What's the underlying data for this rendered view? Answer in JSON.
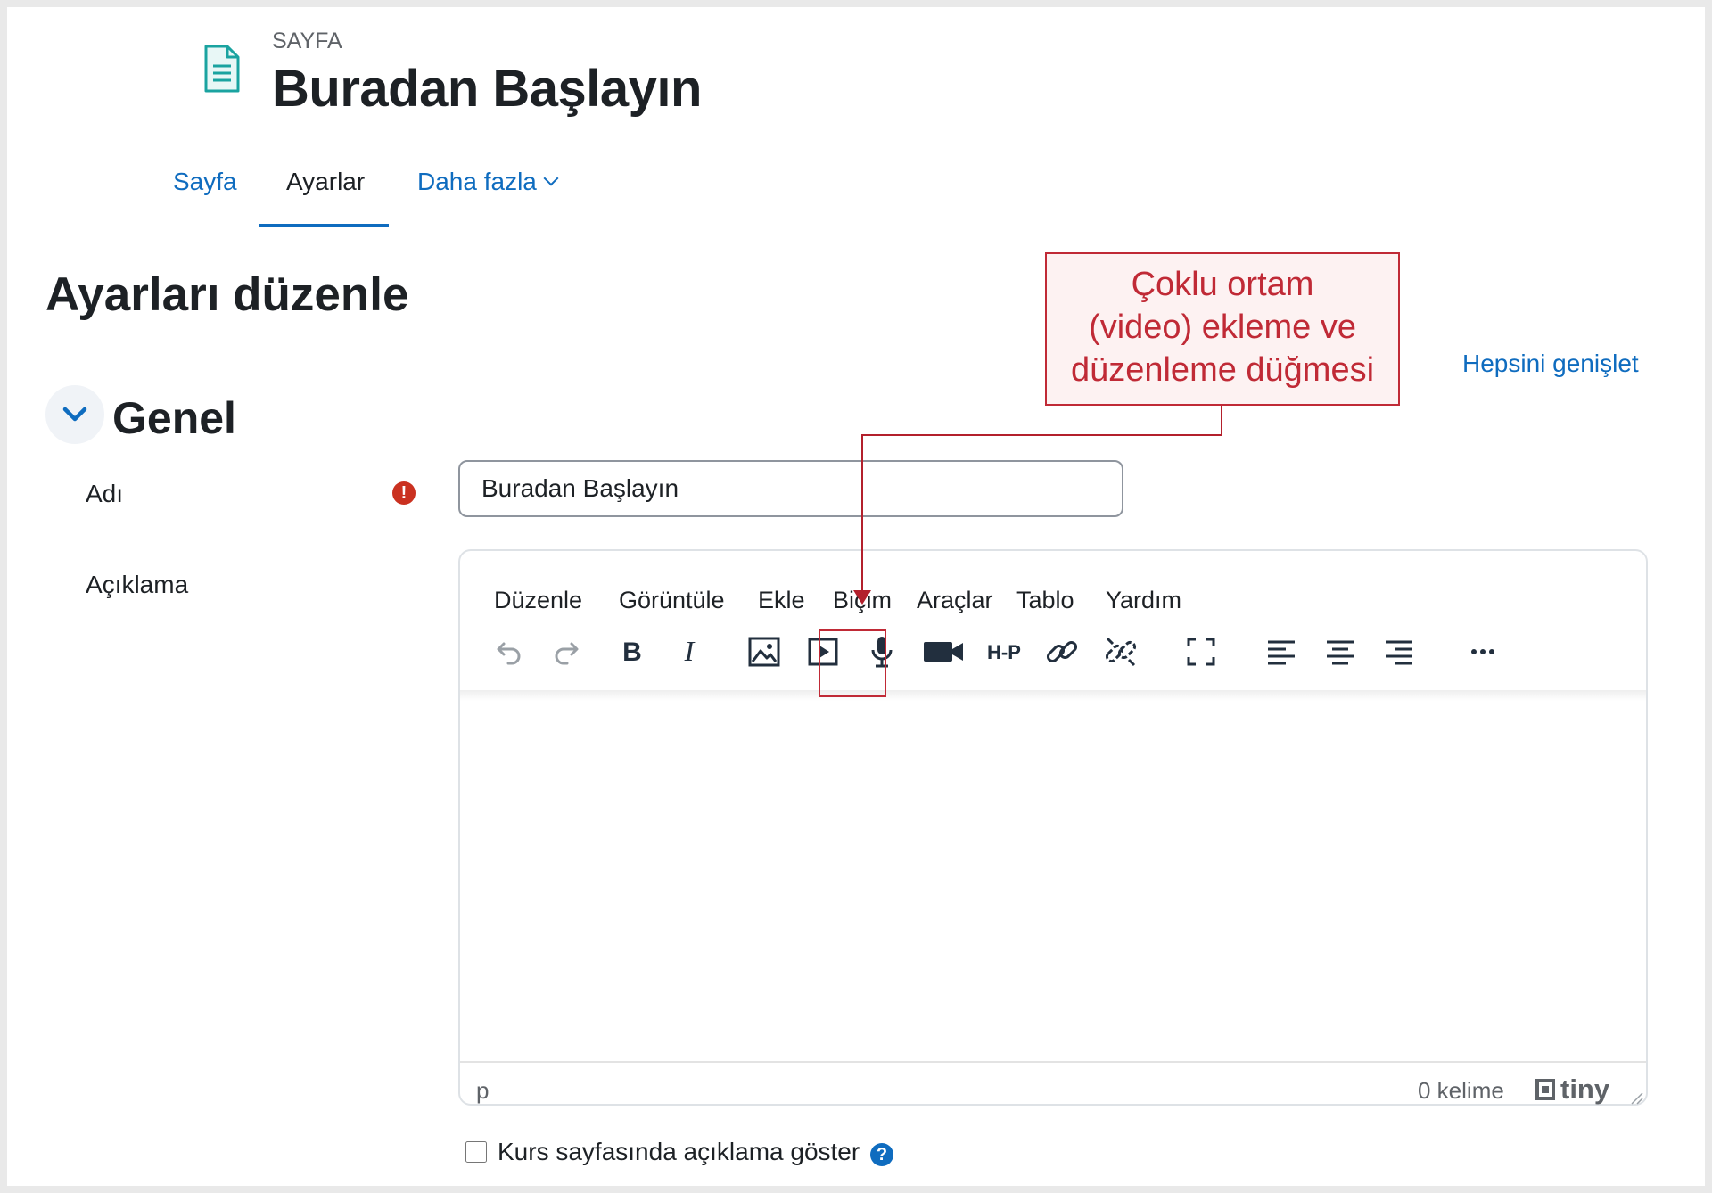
{
  "header": {
    "module_label": "SAYFA",
    "title": "Buradan Başlayın"
  },
  "tabs": [
    {
      "label": "Sayfa",
      "active": false
    },
    {
      "label": "Ayarlar",
      "active": true
    },
    {
      "label": "Daha fazla",
      "active": false
    }
  ],
  "main": {
    "heading": "Ayarları düzenle",
    "expand_all": "Hepsini genişlet",
    "section_title": "Genel"
  },
  "form": {
    "name_label": "Adı",
    "name_value": "Buradan Başlayın",
    "description_label": "Açıklama",
    "show_description_label": "Kurs sayfasında açıklama göster",
    "show_description_checked": false
  },
  "editor": {
    "menu": [
      "Düzenle",
      "Görüntüle",
      "Ekle",
      "Biçim",
      "Araçlar",
      "Tablo",
      "Yardım"
    ],
    "toolbar_icons": [
      "undo-icon",
      "redo-icon",
      "bold-icon",
      "italic-icon",
      "image-icon",
      "media-icon",
      "microphone-icon",
      "video-camera-icon",
      "h5p-icon",
      "link-icon",
      "unlink-icon",
      "fullscreen-icon",
      "align-left-icon",
      "align-center-icon",
      "align-right-icon",
      "more-icon"
    ],
    "status_path": "p",
    "word_count": "0 kelime",
    "brand": "tiny"
  },
  "annotation": {
    "line1": "Çoklu ortam",
    "line2": "(video) ekleme ve",
    "line3": "düzenleme düğmesi"
  },
  "colors": {
    "link": "#0f6cbf",
    "required": "#ca3120",
    "annotation": "#c02a36"
  }
}
